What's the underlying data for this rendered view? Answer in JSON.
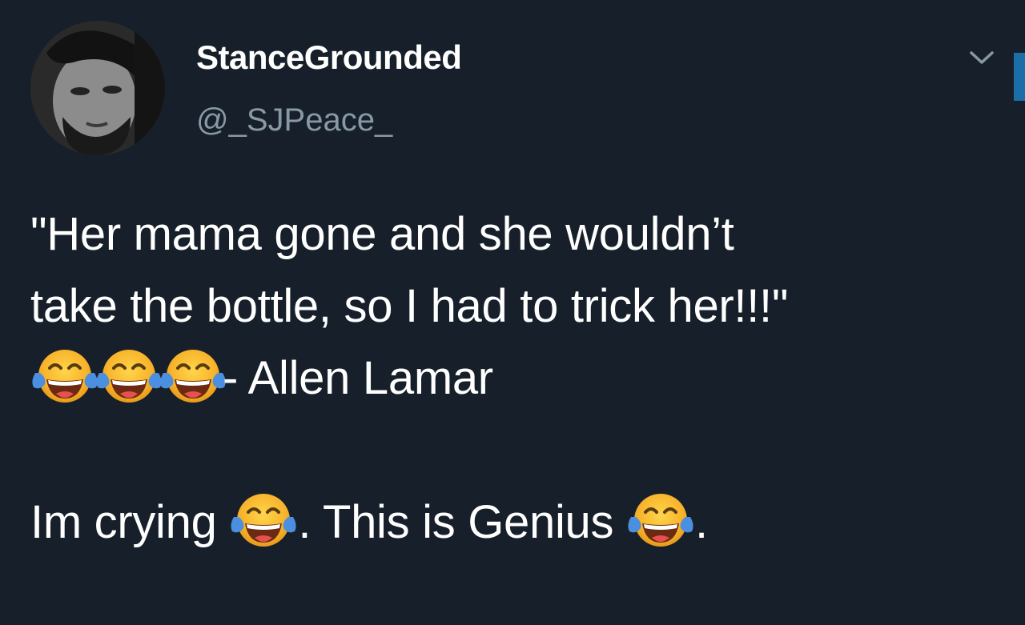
{
  "tweet": {
    "display_name": "StanceGrounded",
    "handle": "@_SJPeace_",
    "menu_icon": "chevron-down-icon",
    "avatar_icon": "profile-photo",
    "line1": "\"Her mama gone and she wouldn’t",
    "line2": "take the bottle, so I had to trick her!!!\"",
    "line3_text": "- Allen Lamar",
    "line5_part1": "Im crying ",
    "line5_part2": ". This is Genius ",
    "line5_part3": ".",
    "emoji_name": "face-with-tears-of-joy",
    "colors": {
      "background": "#17202a",
      "text": "#ffffff",
      "handle": "#8899a6",
      "accent": "#1b6ea8"
    }
  }
}
